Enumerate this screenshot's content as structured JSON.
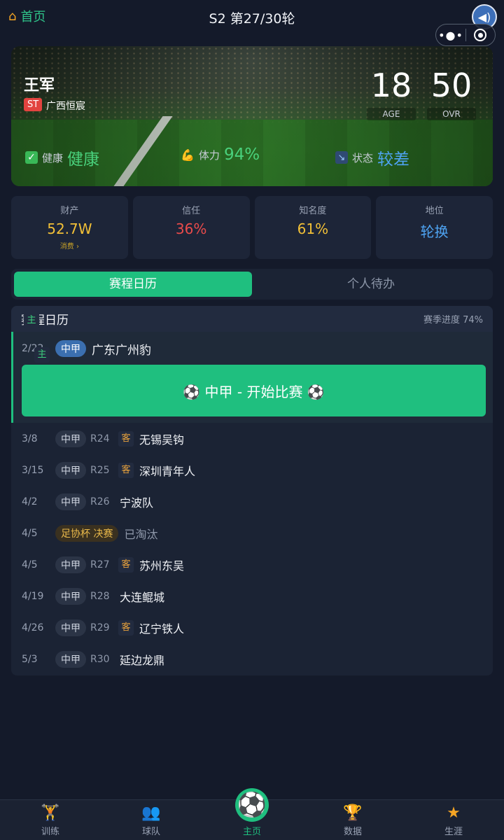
{
  "topbar": {
    "home_label": "首页",
    "round_title": "S2 第27/30轮"
  },
  "player": {
    "name": "王军",
    "position": "ST",
    "club": "广西恒宸",
    "age": "18",
    "age_label": "AGE",
    "ovr": "50",
    "ovr_label": "OVR"
  },
  "conditions": {
    "health": {
      "label": "健康",
      "value": "健康"
    },
    "stamina": {
      "label": "体力",
      "value": "94%"
    },
    "form": {
      "label": "状态",
      "value": "较差"
    }
  },
  "stats": [
    {
      "label": "财产",
      "value": "52.7W",
      "sub": "消费 ›"
    },
    {
      "label": "信任",
      "value": "36%"
    },
    {
      "label": "知名度",
      "value": "61%"
    },
    {
      "label": "地位",
      "value": "轮换"
    }
  ],
  "tabs": [
    {
      "label": "赛程日历"
    },
    {
      "label": "个人待办"
    }
  ],
  "schedule": {
    "title": "赛程日历",
    "progress": "赛季进度 74%",
    "current": {
      "date": "2/22",
      "league": "中甲",
      "ha": "主",
      "opponent": "广东广州豹",
      "button": "⚽ 中甲 - 开始比赛 ⚽"
    },
    "matches": [
      {
        "date": "3/8",
        "league": "中甲",
        "round": "R24",
        "ha": "客",
        "opponent": "无锡吴钩"
      },
      {
        "date": "3/15",
        "league": "中甲",
        "round": "R25",
        "ha": "客",
        "opponent": "深圳青年人"
      },
      {
        "date": "4/2",
        "league": "中甲",
        "round": "R26",
        "ha": "主",
        "opponent": "宁波队"
      },
      {
        "date": "4/5",
        "cup": "足协杯 决赛",
        "status": "已淘汰"
      },
      {
        "date": "4/5",
        "league": "中甲",
        "round": "R27",
        "ha": "客",
        "opponent": "苏州东吴"
      },
      {
        "date": "4/19",
        "league": "中甲",
        "round": "R28",
        "ha": "主",
        "opponent": "大连鲲城"
      },
      {
        "date": "4/26",
        "league": "中甲",
        "round": "R29",
        "ha": "客",
        "opponent": "辽宁铁人"
      },
      {
        "date": "5/3",
        "league": "中甲",
        "round": "R30",
        "ha": "主",
        "opponent": "延边龙鼎"
      }
    ]
  },
  "bottomnav": [
    {
      "label": "训练",
      "icon": "training-icon"
    },
    {
      "label": "球队",
      "icon": "team-icon"
    },
    {
      "label": "主页",
      "icon": "soccer-ball-icon"
    },
    {
      "label": "数据",
      "icon": "trophy-icon"
    },
    {
      "label": "生涯",
      "icon": "star-icon"
    }
  ]
}
